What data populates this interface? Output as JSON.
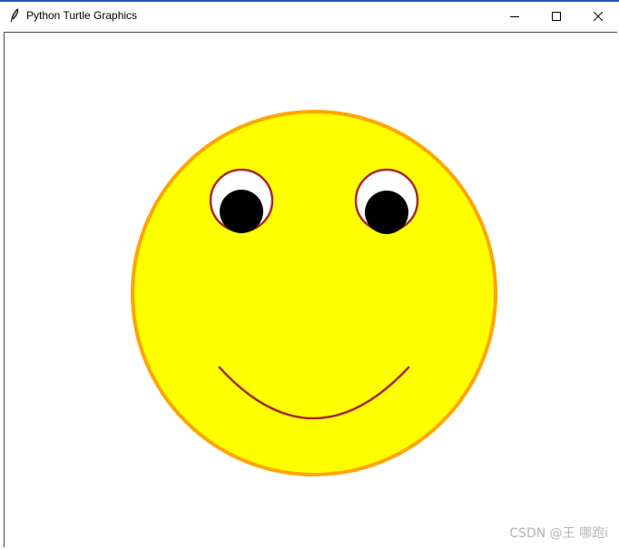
{
  "window": {
    "title": "Python Turtle Graphics",
    "icon": "feather-icon"
  },
  "controls": {
    "minimize": "minimize-icon",
    "maximize": "maximize-icon",
    "close": "close-icon"
  },
  "colors": {
    "face_fill": "#ffff00",
    "face_outline": "#ffa500",
    "eye_white": "#ffffff",
    "eye_outline": "#a52a2a",
    "pupil": "#000000",
    "mouth": "#a52a2a",
    "accent": "#1e5bb0"
  },
  "watermark": {
    "text": "CSDN @王 哪跑i"
  }
}
